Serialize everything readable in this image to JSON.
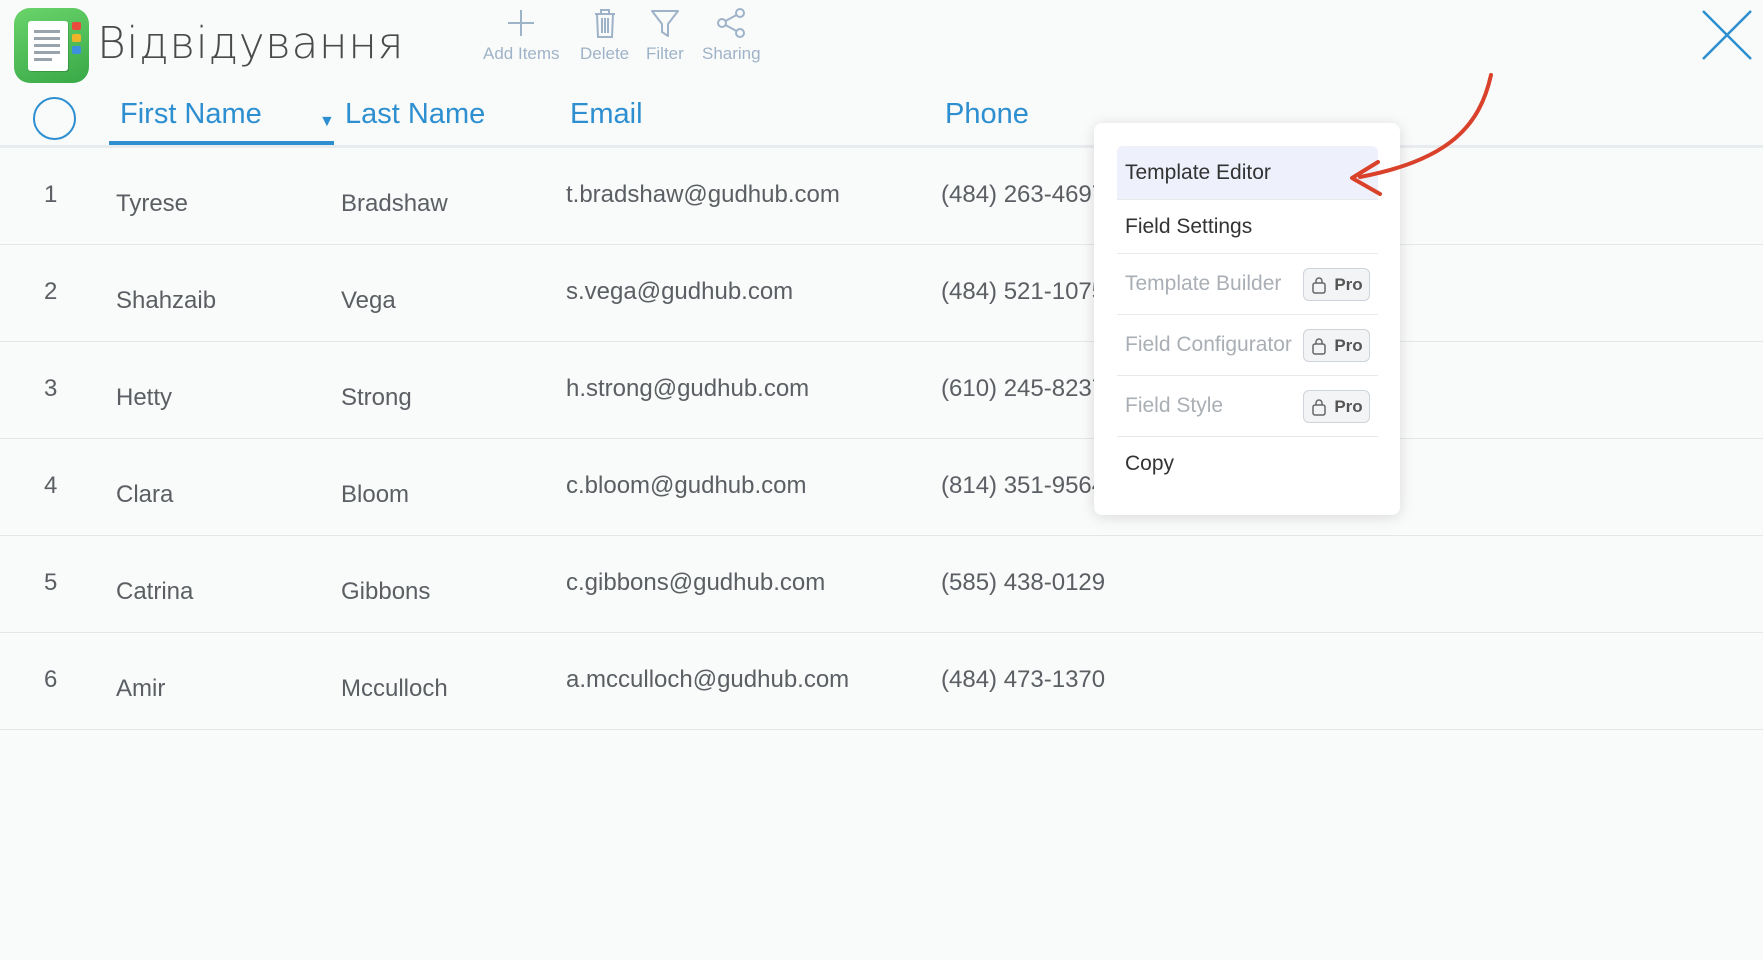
{
  "app": {
    "title": "Відвідування",
    "accent": "#2d8fd0",
    "brand_green": "#4cbf57"
  },
  "toolbar": {
    "add_label": "Add Items",
    "delete_label": "Delete",
    "filter_label": "Filter",
    "sharing_label": "Sharing"
  },
  "table": {
    "columns": [
      "First Name",
      "Last Name",
      "Email",
      "Phone"
    ],
    "sorted_column": "First Name",
    "rows": [
      {
        "num": "1",
        "first": "Tyrese",
        "last": "Bradshaw",
        "email": "t.bradshaw@gudhub.com",
        "phone": "(484) 263-4697"
      },
      {
        "num": "2",
        "first": "Shahzaib",
        "last": "Vega",
        "email": "s.vega@gudhub.com",
        "phone": "(484) 521-1075"
      },
      {
        "num": "3",
        "first": "Hetty",
        "last": "Strong",
        "email": "h.strong@gudhub.com",
        "phone": "(610) 245-8237"
      },
      {
        "num": "4",
        "first": "Clara",
        "last": "Bloom",
        "email": "c.bloom@gudhub.com",
        "phone": "(814) 351-9564"
      },
      {
        "num": "5",
        "first": "Catrina",
        "last": "Gibbons",
        "email": "c.gibbons@gudhub.com",
        "phone": "(585) 438-0129"
      },
      {
        "num": "6",
        "first": "Amir",
        "last": "Mcculloch",
        "email": "a.mcculloch@gudhub.com",
        "phone": "(484) 473-1370"
      }
    ]
  },
  "context_menu": {
    "items": [
      {
        "label": "Template Editor"
      },
      {
        "label": "Field Settings"
      },
      {
        "label": "Template Builder",
        "badge": "Pro"
      },
      {
        "label": "Field Configurator",
        "badge": "Pro"
      },
      {
        "label": "Field Style",
        "badge": "Pro"
      },
      {
        "label": "Copy"
      }
    ]
  },
  "annotation": {
    "arrow_color": "#d9412b"
  }
}
